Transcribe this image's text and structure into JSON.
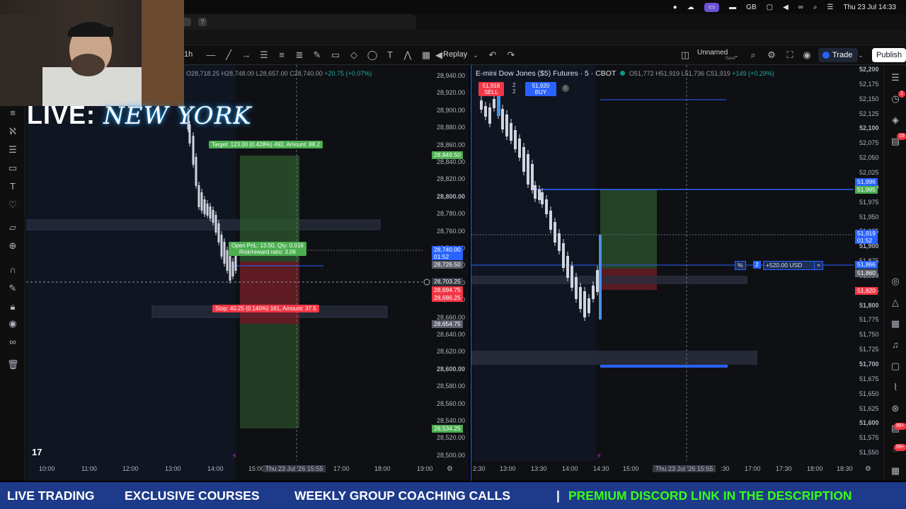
{
  "menubar": {
    "icons": [
      "record-dot-icon",
      "cloud-icon",
      "screen-share-icon",
      "car-icon",
      "keyboard-gb-icon",
      "window-icon",
      "volume-icon",
      "link-icon",
      "search-icon",
      "control-center-icon"
    ],
    "input_source": "GB",
    "clock": "Thu 23 Jul  14:33"
  },
  "toolbar": {
    "interval": "1h",
    "replay_label": "Replay",
    "layout_name": "Unnamed",
    "layout_status": "Save",
    "trade_label": "Trade",
    "publish_label": "Publish"
  },
  "overlay": {
    "live_label": "LIVE:",
    "city_label": "NEW YORK"
  },
  "left_chart": {
    "ohlc": {
      "o": "O28,718.25",
      "h": "H28,748.00",
      "l": "L28,657.00",
      "c": "C28,740.00",
      "chg": "+20.75 (+0.07%)"
    },
    "price_axis": [
      "28,940.00",
      "28,920.00",
      "28,900.00",
      "28,880.00",
      "28,860.00",
      "28,840.00",
      "28,820.00",
      "28,800.00",
      "28,780.00",
      "28,760.00",
      "28,740.00",
      "28,720.00",
      "28,700.00",
      "28,680.00",
      "28,660.00",
      "28,640.00",
      "28,620.00",
      "28,600.00",
      "28,580.00",
      "28,560.00",
      "28,540.00",
      "28,520.00",
      "28,500.00"
    ],
    "price_tags": {
      "target": "28,849.50",
      "last_price": "28,740.00",
      "last_timer": "01:52",
      "entry": "28,726.50",
      "crosshair": "28,703.25",
      "red1": "28,694.75",
      "red2": "28,686.25",
      "gray": "28,654.75",
      "stop": "28,534.25"
    },
    "time_axis": [
      "10:00",
      "11:00",
      "12:00",
      "13:00",
      "14:00",
      "15:00",
      "17:00",
      "18:00",
      "19:00"
    ],
    "time_cursor": "Thu 23 Jul '26  15:55",
    "position": {
      "target_label": "Target: 123.00 (0.428%) 492, Amount: 88.2",
      "open_pnl_label": "Open PnL: 13.50, Qty: 0.016",
      "rr_label": "Risk/reward ratio: 3.06",
      "stop_label": "Stop: 40.25 (0.140%) 161, Amount: 37.5"
    }
  },
  "right_chart": {
    "symbol": "E-mini Dow Jones ($5) Futures · 5 · CBOT",
    "ohlc": {
      "o": "O51,772",
      "h": "H51,919",
      "l": "L51,736",
      "c": "C51,919",
      "chg": "+149 (+0.29%)"
    },
    "sell_price": "51,918",
    "sell_label": "SELL",
    "qty_top": "2",
    "qty_bottom": "2",
    "buy_price": "51,920",
    "buy_label": "BUY",
    "price_axis": [
      "52,200",
      "52,175",
      "52,150",
      "52,125",
      "52,100",
      "52,075",
      "52,050",
      "52,025",
      "52,000",
      "51,975",
      "51,950",
      "51,925",
      "51,900",
      "51,875",
      "51,850",
      "51,825",
      "51,800",
      "51,775",
      "51,750",
      "51,725",
      "51,700",
      "51,675",
      "51,650",
      "51,625",
      "51,600",
      "51,575",
      "51,550"
    ],
    "price_tags": {
      "blue_line1": "51,996",
      "green": "51,995",
      "last_price": "51,919",
      "last_timer": "01:52",
      "blue_line2": "51,866",
      "gray": "51,860",
      "red": "51,820"
    },
    "order_line": {
      "percent": "%",
      "qty": "2",
      "pnl": "+520.00 USD",
      "close": "×"
    },
    "time_axis": [
      "2:30",
      "13:00",
      "13:30",
      "14:00",
      "14:30",
      "15:00",
      "17:00",
      "17:30",
      "18:00",
      "18:30"
    ],
    "time_cursor": "Thu 23 Jul '26  15:55",
    "time_cursor_tail": ":30"
  },
  "right_sidebar": {
    "badge1": "1",
    "badge2": "19",
    "badge3": "99+",
    "badge4": "99+"
  },
  "banner": {
    "item1": "LIVE TRADING",
    "item2": "EXCLUSIVE COURSES",
    "item3": "WEEKLY GROUP COACHING CALLS",
    "separator": "|",
    "item4": "PREMIUM DISCORD LINK IN THE DESCRIPTION"
  },
  "colors": {
    "bull": "#26a69a",
    "bear": "#f23645",
    "blue": "#2962ff",
    "candle": "#d1d4dc",
    "banner_bg": "#1e3a8a",
    "banner_accent": "#39ff14"
  }
}
